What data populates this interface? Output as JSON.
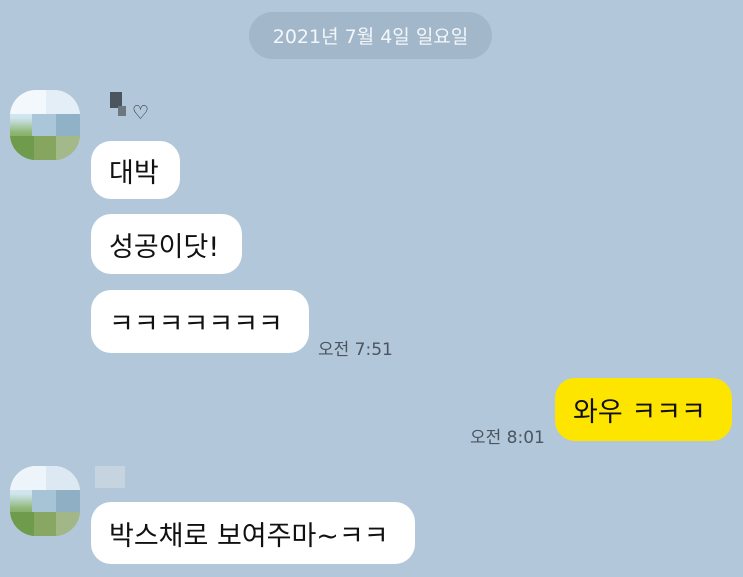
{
  "date_divider": "2021년 7월 4일 일요일",
  "sender_name_suffix": "♡",
  "received_messages": [
    {
      "text": "대박"
    },
    {
      "text": "성공이닷!"
    },
    {
      "text": "ㅋㅋㅋㅋㅋㅋㅋ",
      "time": "오전 7:51"
    }
  ],
  "sent_messages": [
    {
      "text": "와우 ㅋㅋㅋ",
      "time": "오전 8:01"
    }
  ],
  "received_messages_2": [
    {
      "text": "박스채로 보여주마~ㅋㅋ"
    }
  ],
  "colors": {
    "background": "#b2c7d9",
    "received_bubble": "#ffffff",
    "sent_bubble": "#fee500",
    "date_pill": "#a2b7c9"
  }
}
